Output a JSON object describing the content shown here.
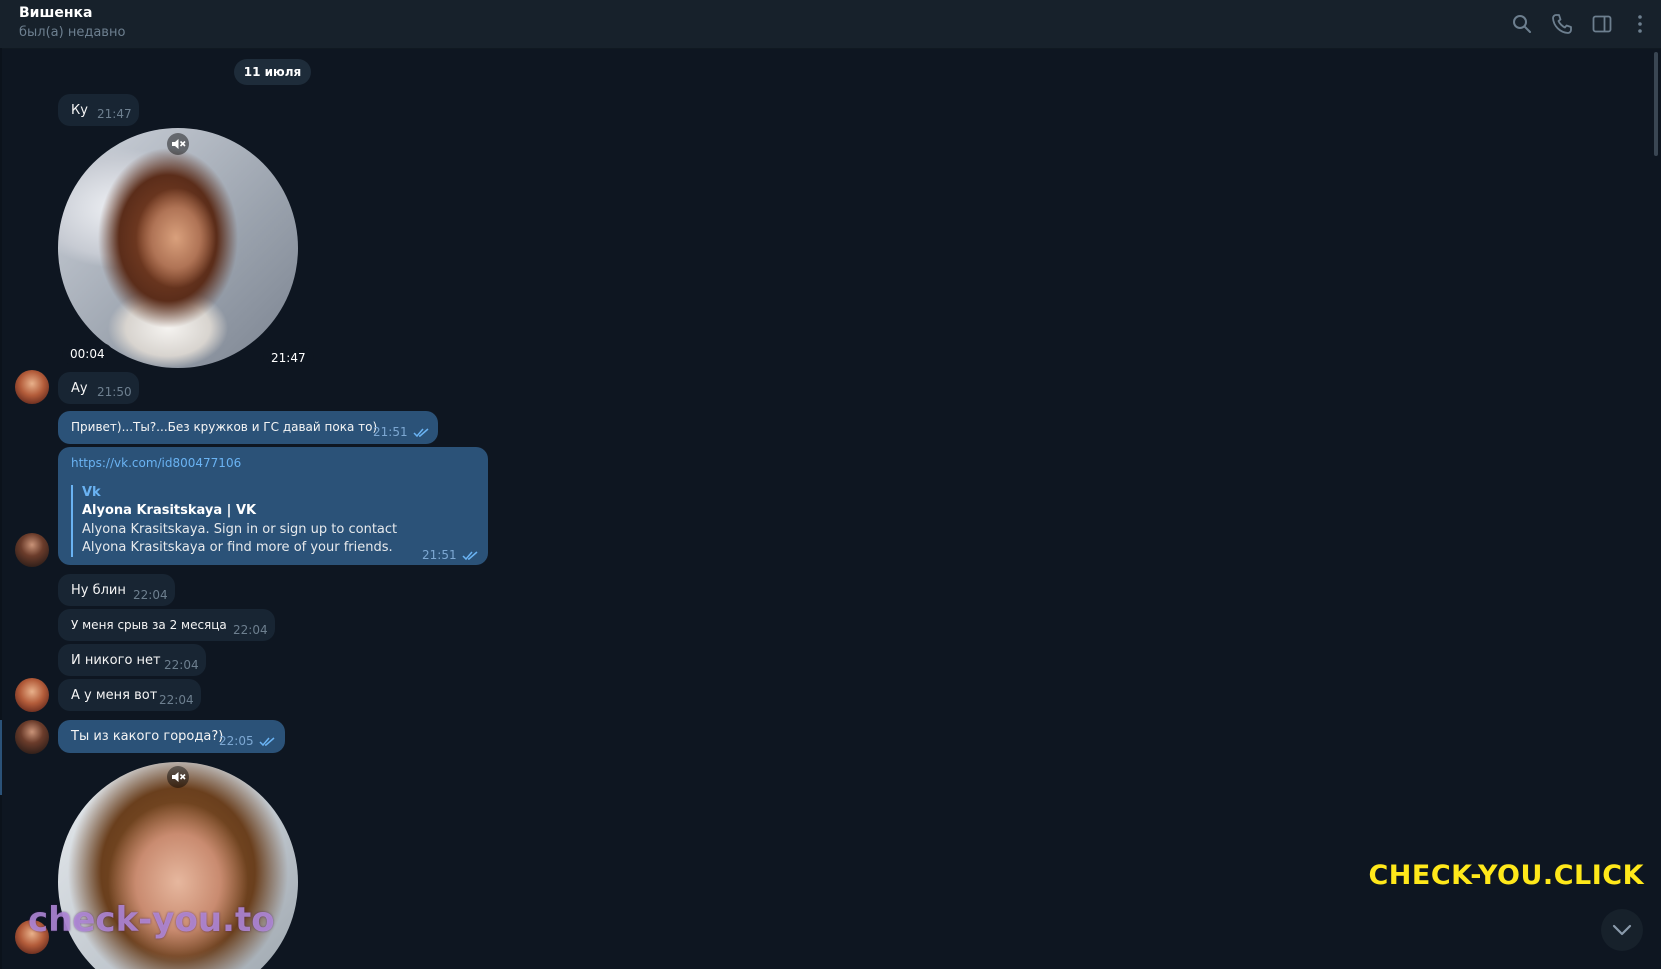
{
  "header": {
    "title": "Вишенка",
    "status": "был(а) недавно",
    "icons": [
      "search-icon",
      "phone-icon",
      "sidebar-icon",
      "more-icon"
    ]
  },
  "date_separator": "11 июля",
  "messages": [
    {
      "type": "text",
      "dir": "in",
      "text": "Ку",
      "time": "21:47"
    },
    {
      "type": "round-video",
      "dir": "in",
      "duration": "00:04",
      "time": "21:47"
    },
    {
      "type": "text",
      "dir": "in",
      "text": "Ау",
      "time": "21:50"
    },
    {
      "type": "text",
      "dir": "out",
      "text": "Привет)...Ты?...Без кружков и ГС давай пока то)",
      "time": "21:51",
      "read": true
    },
    {
      "type": "link",
      "dir": "out",
      "url": "https://vk.com/id800477106",
      "preview": {
        "site": "Vk",
        "title": "Alyona Krasitskaya | VK",
        "description": "Alyona Krasitskaya. Sign in or sign up to contact Alyona Krasitskaya or find more of your friends."
      },
      "time": "21:51",
      "read": true
    },
    {
      "type": "text",
      "dir": "in",
      "text": "Ну блин",
      "time": "22:04"
    },
    {
      "type": "text",
      "dir": "in",
      "text": "У меня срыв за 2 месяца",
      "time": "22:04"
    },
    {
      "type": "text",
      "dir": "in",
      "text": "И никого нет",
      "time": "22:04"
    },
    {
      "type": "text",
      "dir": "in",
      "text": "А у меня вот",
      "time": "22:04"
    },
    {
      "type": "text",
      "dir": "out",
      "text": "Ты из какого города?)",
      "time": "22:05",
      "read": true
    },
    {
      "type": "round-video",
      "dir": "in"
    }
  ],
  "watermarks": {
    "yellow": "CHECK-YOU.CLICK",
    "purple": "check-you.to"
  },
  "colors": {
    "background": "#0e1621",
    "header": "#17212b",
    "incoming_bubble": "#182533",
    "outgoing_bubble": "#2b5278",
    "link": "#6ab3f3",
    "watermark_yellow": "#ffe81a"
  }
}
